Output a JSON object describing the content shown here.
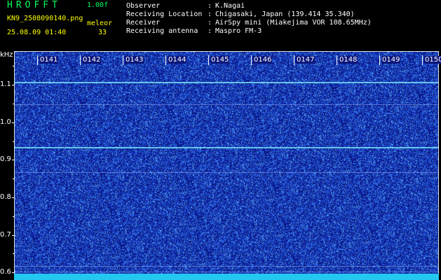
{
  "header": {
    "app_title": "HROFFT",
    "version": "1.00f",
    "file_name": "KN9_2508090140.png",
    "date_time": "25.08.09 01:40",
    "mode_label": "meleor",
    "count": "33"
  },
  "station": {
    "rows": [
      {
        "label": "Observer",
        "sep": ":",
        "value": "K.Nagai"
      },
      {
        "label": "Receiving Location",
        "sep": ":",
        "value": "Chigasaki, Japan (139.414 35.340)"
      },
      {
        "label": "Receiver",
        "sep": ":",
        "value": "AirSpy mini (Miakejima VOR 108.65MHz)"
      },
      {
        "label": "Receiving antenna",
        "sep": ":",
        "value": "Maspro FM-3"
      }
    ]
  },
  "spectrogram": {
    "y_unit": "kHz",
    "y_ticks": [
      "1.1",
      "1.0",
      "0.9",
      "0.8",
      "0.7",
      "0.6"
    ],
    "time_labels": [
      "0141",
      "0142",
      "0143",
      "0144",
      "0145",
      "0146",
      "0147",
      "0148",
      "0149",
      "0150"
    ],
    "y_range_khz": [
      0.58,
      1.19
    ],
    "carrier_lines_khz": [
      1.11,
      0.937
    ],
    "faint_lines_khz": [
      1.05,
      0.87,
      0.62,
      0.605
    ],
    "colors": {
      "background": "#0a157a",
      "noise": "#3a6bff",
      "carrier": "#7ff0ff",
      "bottom_band": "#22c8f0",
      "title_green": "#00ff60",
      "header_yellow": "#ffff00"
    }
  }
}
